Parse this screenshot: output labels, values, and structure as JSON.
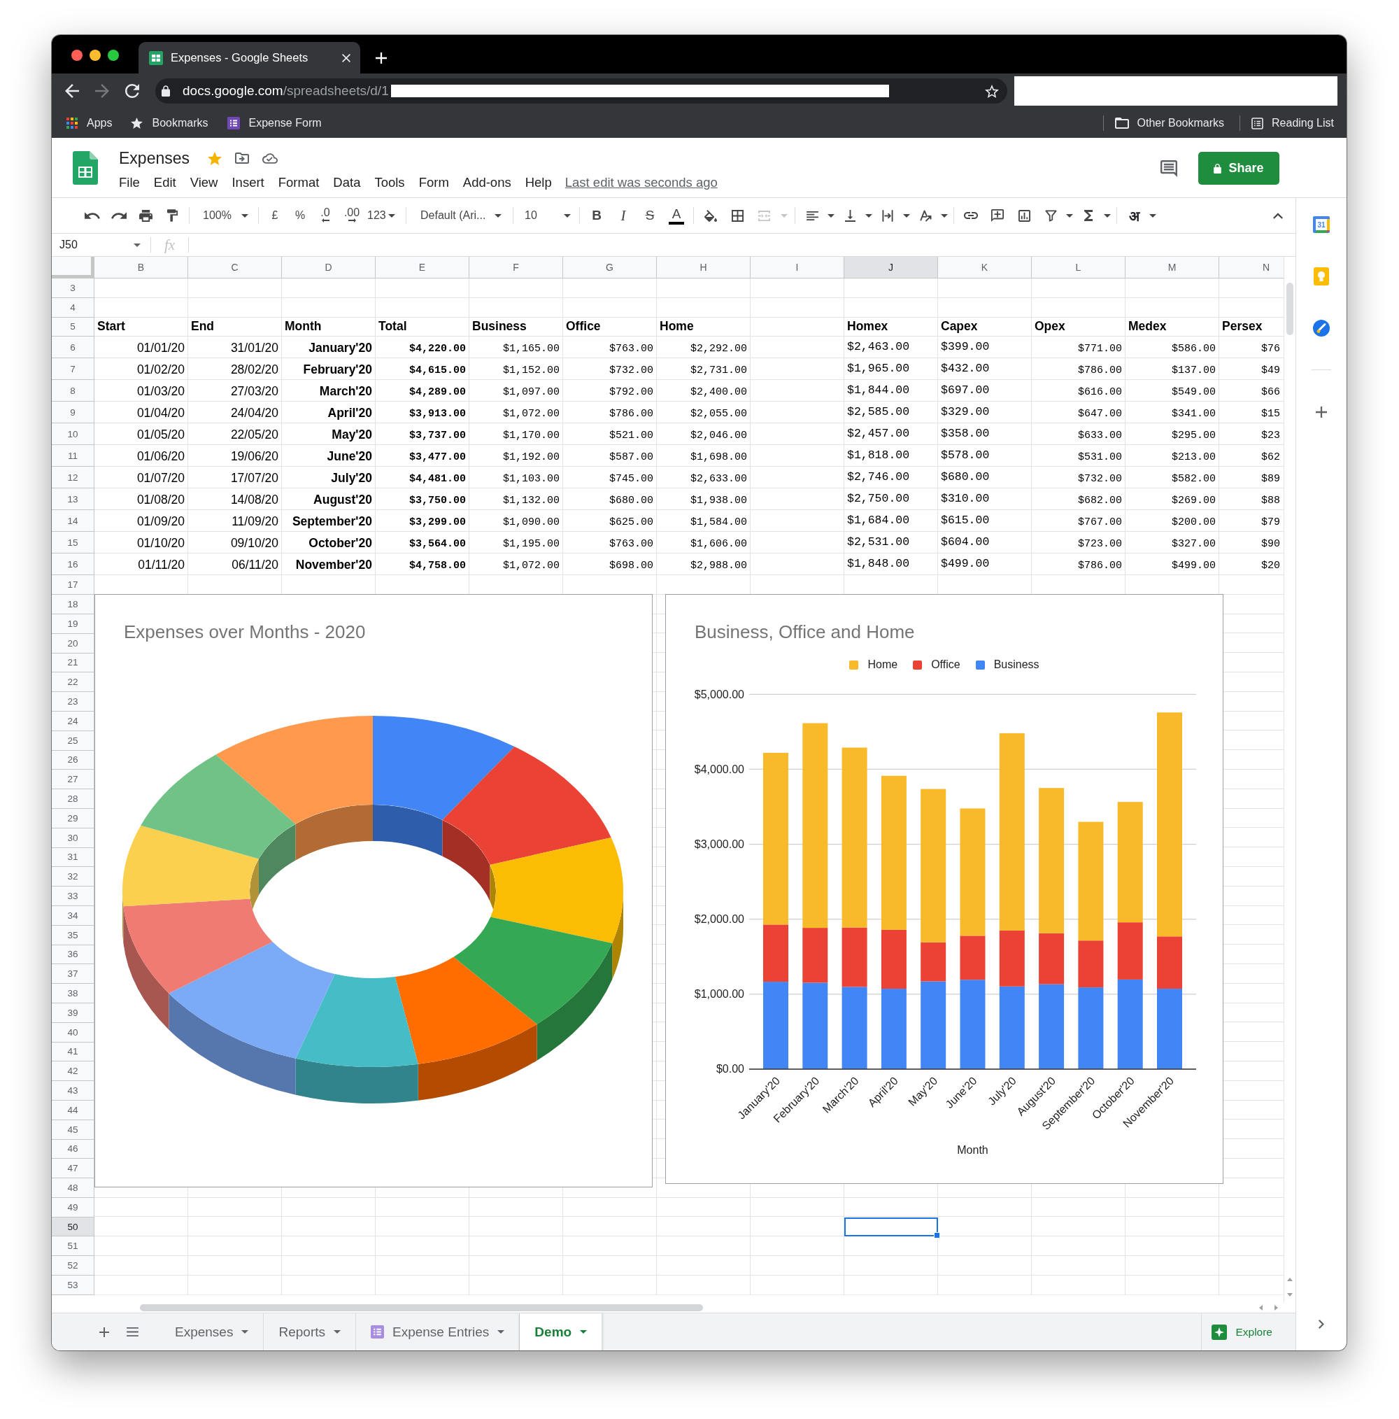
{
  "browser": {
    "tabs": [
      {
        "title": "Expenses - Google Sheets",
        "selected": true
      }
    ],
    "forward": {
      "disabled": true
    },
    "url": {
      "host": "docs.google.com",
      "path": "/spreadsheets/d/1"
    },
    "bookmarks": [
      {
        "label": "Apps",
        "kind": "apps"
      },
      {
        "label": "Bookmarks",
        "kind": "star"
      },
      {
        "label": "Expense Form",
        "kind": "form"
      }
    ],
    "bookmarks_right": [
      {
        "label": "Other Bookmarks",
        "kind": "folder"
      },
      {
        "label": "Reading List",
        "kind": "reading-list"
      }
    ]
  },
  "document": {
    "title": "Expenses",
    "starred": true,
    "menu": [
      "File",
      "Edit",
      "View",
      "Insert",
      "Format",
      "Data",
      "Tools",
      "Form",
      "Add-ons",
      "Help"
    ],
    "last_edit": "Last edit was seconds ago",
    "share": "Share"
  },
  "toolbar": {
    "zoom": "100%",
    "currency": "£",
    "percent": "%",
    "decrease_decimals": ".0",
    "increase_decimals": ".00",
    "more_formats": "123",
    "font": "Default (Ari...",
    "font_size": "10",
    "bold": "B",
    "italic": "I",
    "strikethrough": "S",
    "text_color": "A",
    "merge_disabled": true,
    "input_tools": "अ"
  },
  "formula_bar": {
    "name_box": "J50",
    "function_label": "fx"
  },
  "side_panel": {
    "calendar_date": "31"
  },
  "grid": {
    "columns": [
      {
        "label": "B",
        "selected": false
      },
      {
        "label": "C",
        "selected": false
      },
      {
        "label": "D",
        "selected": false
      },
      {
        "label": "E",
        "selected": false
      },
      {
        "label": "F",
        "selected": false
      },
      {
        "label": "G",
        "selected": false
      },
      {
        "label": "H",
        "selected": false
      },
      {
        "label": "I",
        "selected": false
      },
      {
        "label": "J",
        "selected": true
      },
      {
        "label": "K",
        "selected": false
      },
      {
        "label": "L",
        "selected": false
      },
      {
        "label": "M",
        "selected": false
      },
      {
        "label": "N",
        "selected": false
      }
    ],
    "rows": [
      {
        "number": "3",
        "selected": false,
        "kind": "empty"
      },
      {
        "number": "4",
        "selected": false,
        "kind": "empty"
      },
      {
        "number": "5",
        "selected": false,
        "kind": "header",
        "cells": [
          "Start",
          "End",
          "Month",
          "Total",
          "Business",
          "Office",
          "Home",
          null,
          "Homex",
          "Capex",
          "Opex",
          "Medex",
          "Persex"
        ]
      },
      {
        "number": "6",
        "selected": false,
        "kind": "data",
        "cells": [
          "01/01/20",
          "31/01/20",
          "January'20",
          "$4,220.00",
          "$1,165.00",
          "$763.00",
          "$2,292.00",
          null,
          "$2,463.00",
          "$399.00",
          "$771.00",
          "$586.00",
          "$76"
        ]
      },
      {
        "number": "7",
        "selected": false,
        "kind": "data",
        "cells": [
          "01/02/20",
          "28/02/20",
          "February'20",
          "$4,615.00",
          "$1,152.00",
          "$732.00",
          "$2,731.00",
          null,
          "$1,965.00",
          "$432.00",
          "$786.00",
          "$137.00",
          "$49"
        ]
      },
      {
        "number": "8",
        "selected": false,
        "kind": "data",
        "cells": [
          "01/03/20",
          "27/03/20",
          "March'20",
          "$4,289.00",
          "$1,097.00",
          "$792.00",
          "$2,400.00",
          null,
          "$1,844.00",
          "$697.00",
          "$616.00",
          "$549.00",
          "$66"
        ]
      },
      {
        "number": "9",
        "selected": false,
        "kind": "data",
        "cells": [
          "01/04/20",
          "24/04/20",
          "April'20",
          "$3,913.00",
          "$1,072.00",
          "$786.00",
          "$2,055.00",
          null,
          "$2,585.00",
          "$329.00",
          "$647.00",
          "$341.00",
          "$15"
        ]
      },
      {
        "number": "10",
        "selected": false,
        "kind": "data",
        "cells": [
          "01/05/20",
          "22/05/20",
          "May'20",
          "$3,737.00",
          "$1,170.00",
          "$521.00",
          "$2,046.00",
          null,
          "$2,457.00",
          "$358.00",
          "$633.00",
          "$295.00",
          "$23"
        ]
      },
      {
        "number": "11",
        "selected": false,
        "kind": "data",
        "cells": [
          "01/06/20",
          "19/06/20",
          "June'20",
          "$3,477.00",
          "$1,192.00",
          "$587.00",
          "$1,698.00",
          null,
          "$1,818.00",
          "$578.00",
          "$531.00",
          "$213.00",
          "$62"
        ]
      },
      {
        "number": "12",
        "selected": false,
        "kind": "data",
        "cells": [
          "01/07/20",
          "17/07/20",
          "July'20",
          "$4,481.00",
          "$1,103.00",
          "$745.00",
          "$2,633.00",
          null,
          "$2,746.00",
          "$680.00",
          "$732.00",
          "$582.00",
          "$89"
        ]
      },
      {
        "number": "13",
        "selected": false,
        "kind": "data",
        "cells": [
          "01/08/20",
          "14/08/20",
          "August'20",
          "$3,750.00",
          "$1,132.00",
          "$680.00",
          "$1,938.00",
          null,
          "$2,750.00",
          "$310.00",
          "$682.00",
          "$269.00",
          "$88"
        ]
      },
      {
        "number": "14",
        "selected": false,
        "kind": "data",
        "cells": [
          "01/09/20",
          "11/09/20",
          "September'20",
          "$3,299.00",
          "$1,090.00",
          "$625.00",
          "$1,584.00",
          null,
          "$1,684.00",
          "$615.00",
          "$767.00",
          "$200.00",
          "$79"
        ]
      },
      {
        "number": "15",
        "selected": false,
        "kind": "data",
        "cells": [
          "01/10/20",
          "09/10/20",
          "October'20",
          "$3,564.00",
          "$1,195.00",
          "$763.00",
          "$1,606.00",
          null,
          "$2,531.00",
          "$604.00",
          "$723.00",
          "$327.00",
          "$90"
        ]
      },
      {
        "number": "16",
        "selected": false,
        "kind": "data",
        "cells": [
          "01/11/20",
          "06/11/20",
          "November'20",
          "$4,758.00",
          "$1,072.00",
          "$698.00",
          "$2,988.00",
          null,
          "$1,848.00",
          "$499.00",
          "$786.00",
          "$499.00",
          "$20"
        ]
      },
      {
        "number": "17",
        "selected": false,
        "kind": "empty"
      },
      {
        "number": "18",
        "selected": false,
        "kind": "empty"
      },
      {
        "number": "19",
        "selected": false,
        "kind": "empty"
      },
      {
        "number": "20",
        "selected": false,
        "kind": "empty"
      },
      {
        "number": "21",
        "selected": false,
        "kind": "empty"
      },
      {
        "number": "22",
        "selected": false,
        "kind": "empty"
      },
      {
        "number": "23",
        "selected": false,
        "kind": "empty"
      },
      {
        "number": "24",
        "selected": false,
        "kind": "empty"
      },
      {
        "number": "25",
        "selected": false,
        "kind": "empty"
      },
      {
        "number": "26",
        "selected": false,
        "kind": "empty"
      },
      {
        "number": "27",
        "selected": false,
        "kind": "empty"
      },
      {
        "number": "28",
        "selected": false,
        "kind": "empty"
      },
      {
        "number": "29",
        "selected": false,
        "kind": "empty"
      },
      {
        "number": "30",
        "selected": false,
        "kind": "empty"
      },
      {
        "number": "31",
        "selected": false,
        "kind": "empty"
      },
      {
        "number": "32",
        "selected": false,
        "kind": "empty"
      },
      {
        "number": "33",
        "selected": false,
        "kind": "empty"
      },
      {
        "number": "34",
        "selected": false,
        "kind": "empty"
      },
      {
        "number": "35",
        "selected": false,
        "kind": "empty"
      },
      {
        "number": "36",
        "selected": false,
        "kind": "empty"
      },
      {
        "number": "37",
        "selected": false,
        "kind": "empty"
      },
      {
        "number": "38",
        "selected": false,
        "kind": "empty"
      },
      {
        "number": "39",
        "selected": false,
        "kind": "empty"
      },
      {
        "number": "40",
        "selected": false,
        "kind": "empty"
      },
      {
        "number": "41",
        "selected": false,
        "kind": "empty"
      },
      {
        "number": "42",
        "selected": false,
        "kind": "empty"
      },
      {
        "number": "43",
        "selected": false,
        "kind": "empty"
      },
      {
        "number": "44",
        "selected": false,
        "kind": "empty"
      },
      {
        "number": "45",
        "selected": false,
        "kind": "empty"
      },
      {
        "number": "46",
        "selected": false,
        "kind": "empty"
      },
      {
        "number": "47",
        "selected": false,
        "kind": "empty"
      },
      {
        "number": "48",
        "selected": false,
        "kind": "empty"
      },
      {
        "number": "49",
        "selected": false,
        "kind": "empty"
      },
      {
        "number": "50",
        "selected": true,
        "kind": "empty"
      },
      {
        "number": "51",
        "selected": false,
        "kind": "empty"
      },
      {
        "number": "52",
        "selected": false,
        "kind": "empty"
      },
      {
        "number": "53",
        "selected": false,
        "kind": "empty"
      }
    ]
  },
  "charts": {
    "pie_chart": {
      "title": "Expenses over Months - 2020"
    },
    "bar_chart": {
      "chart_data": {
        "type": "bar",
        "title": "Business, Office and Home",
        "xlabel": "Month",
        "categories": [
          "January'20",
          "February'20",
          "March'20",
          "April'20",
          "May'20",
          "June'20",
          "July'20",
          "August'20",
          "September'20",
          "October'20",
          "November'20"
        ],
        "series": [
          {
            "name": "Business",
            "color": "#4285f4",
            "values": [
              1165,
              1152,
              1097,
              1072,
              1170,
              1192,
              1103,
              1132,
              1090,
              1195,
              1072
            ]
          },
          {
            "name": "Office",
            "color": "#ea4335",
            "values": [
              763,
              732,
              792,
              786,
              521,
              587,
              745,
              680,
              625,
              763,
              698
            ]
          },
          {
            "name": "Home",
            "color": "#f8b92b",
            "values": [
              2292,
              2731,
              2400,
              2055,
              2046,
              1698,
              2633,
              1938,
              1584,
              1606,
              2988
            ]
          }
        ],
        "ylim": [
          0,
          5000
        ],
        "yticks": [
          {
            "value": 0,
            "label": "$0.00"
          },
          {
            "value": 1000,
            "label": "$1,000.00"
          },
          {
            "value": 2000,
            "label": "$2,000.00"
          },
          {
            "value": 3000,
            "label": "$3,000.00"
          },
          {
            "value": 4000,
            "label": "$4,000.00"
          },
          {
            "value": 5000,
            "label": "$5,000.00"
          }
        ],
        "stacked": true,
        "orientation": "vertical",
        "grid": true,
        "legend": "top"
      }
    }
  },
  "sheet_tabs": [
    {
      "label": "Expenses",
      "selected": false,
      "kind": "sheet"
    },
    {
      "label": "Reports",
      "selected": false,
      "kind": "sheet"
    },
    {
      "label": "Expense Entries",
      "selected": false,
      "kind": "form"
    },
    {
      "label": "Demo",
      "selected": true,
      "kind": "sheet"
    }
  ],
  "explore": "Explore"
}
